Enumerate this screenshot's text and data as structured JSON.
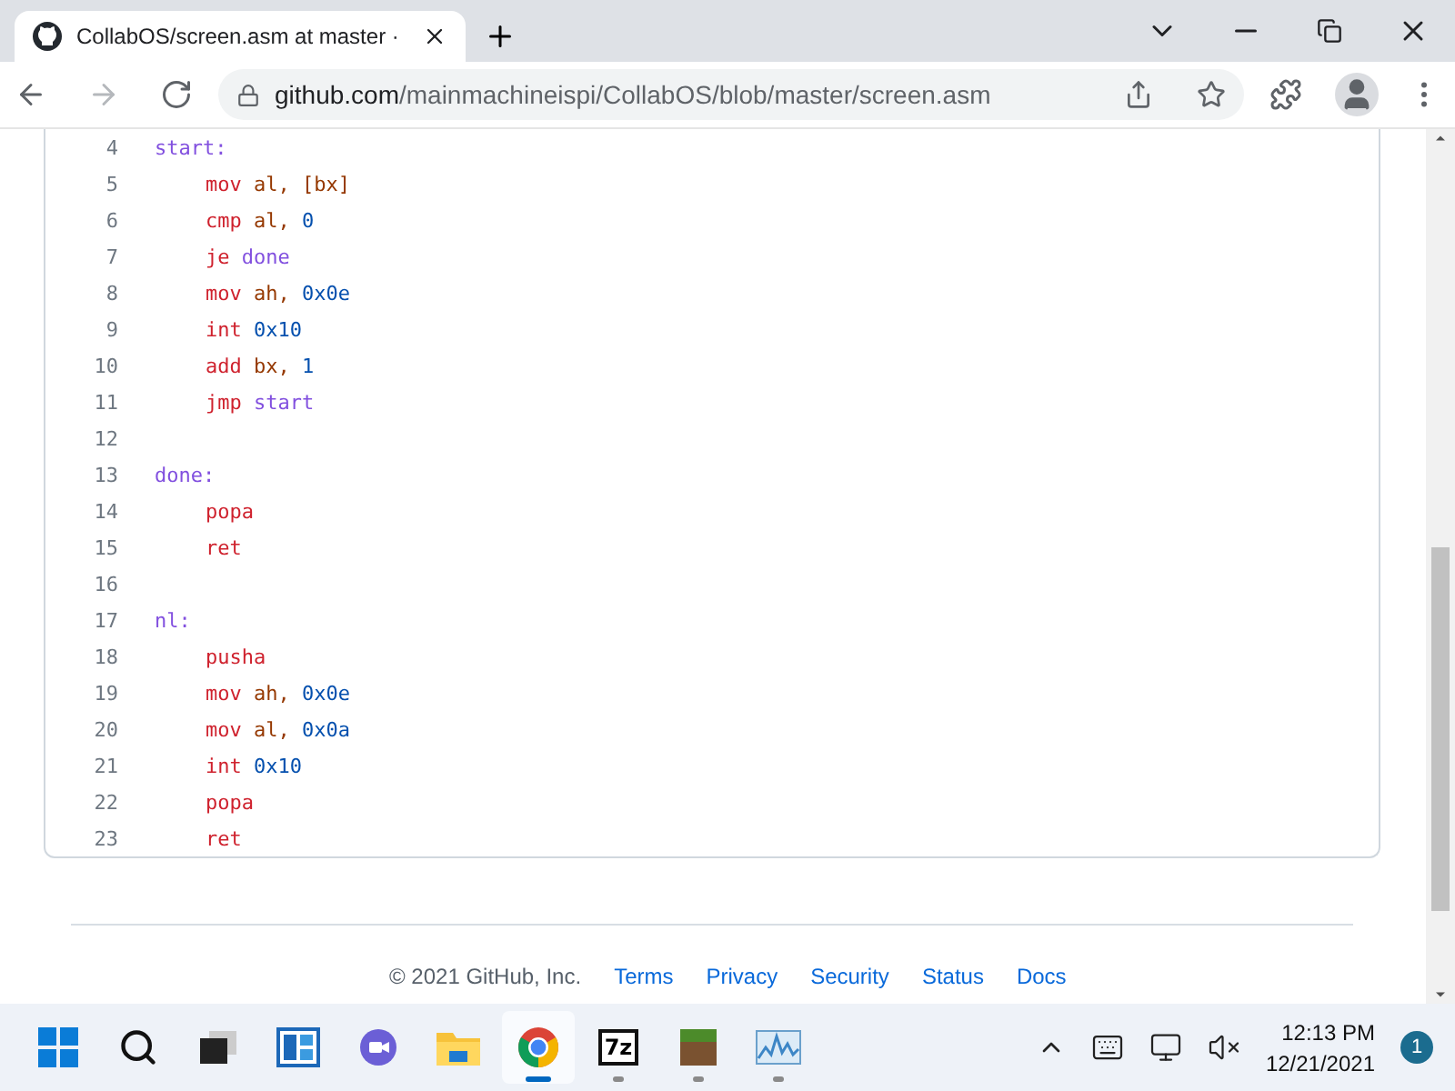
{
  "browser": {
    "tab": {
      "title": "CollabOS/screen.asm at master ·",
      "selected": true
    },
    "url": {
      "host": "github.com",
      "path": "/mainmachineispi/CollabOS/blob/master/screen.asm"
    }
  },
  "code": [
    {
      "number": "4",
      "indent": false,
      "tokens": [
        {
          "text": "start:",
          "kind": "label"
        }
      ]
    },
    {
      "number": "5",
      "indent": true,
      "tokens": [
        {
          "text": "mov",
          "kind": "keyword"
        },
        {
          "text": "al,",
          "kind": "register"
        },
        {
          "text": "[bx]",
          "kind": "register"
        }
      ]
    },
    {
      "number": "6",
      "indent": true,
      "tokens": [
        {
          "text": "cmp",
          "kind": "keyword"
        },
        {
          "text": "al,",
          "kind": "register"
        },
        {
          "text": "0",
          "kind": "number"
        }
      ]
    },
    {
      "number": "7",
      "indent": true,
      "tokens": [
        {
          "text": "je",
          "kind": "keyword"
        },
        {
          "text": "done",
          "kind": "label"
        }
      ]
    },
    {
      "number": "8",
      "indent": true,
      "tokens": [
        {
          "text": "mov",
          "kind": "keyword"
        },
        {
          "text": "ah,",
          "kind": "register"
        },
        {
          "text": "0x0e",
          "kind": "number"
        }
      ]
    },
    {
      "number": "9",
      "indent": true,
      "tokens": [
        {
          "text": "int",
          "kind": "keyword"
        },
        {
          "text": "0x10",
          "kind": "number"
        }
      ]
    },
    {
      "number": "10",
      "indent": true,
      "tokens": [
        {
          "text": "add",
          "kind": "keyword"
        },
        {
          "text": "bx,",
          "kind": "register"
        },
        {
          "text": "1",
          "kind": "number"
        }
      ]
    },
    {
      "number": "11",
      "indent": true,
      "tokens": [
        {
          "text": "jmp",
          "kind": "keyword"
        },
        {
          "text": "start",
          "kind": "label"
        }
      ]
    },
    {
      "number": "12"
    },
    {
      "number": "13",
      "indent": false,
      "tokens": [
        {
          "text": "done:",
          "kind": "label"
        }
      ]
    },
    {
      "number": "14",
      "indent": true,
      "tokens": [
        {
          "text": "popa",
          "kind": "keyword"
        }
      ]
    },
    {
      "number": "15",
      "indent": true,
      "tokens": [
        {
          "text": "ret",
          "kind": "keyword"
        }
      ]
    },
    {
      "number": "16"
    },
    {
      "number": "17",
      "indent": false,
      "tokens": [
        {
          "text": "nl:",
          "kind": "label"
        }
      ]
    },
    {
      "number": "18",
      "indent": true,
      "tokens": [
        {
          "text": "pusha",
          "kind": "keyword"
        }
      ]
    },
    {
      "number": "19",
      "indent": true,
      "tokens": [
        {
          "text": "mov",
          "kind": "keyword"
        },
        {
          "text": "ah,",
          "kind": "register"
        },
        {
          "text": "0x0e",
          "kind": "number"
        }
      ]
    },
    {
      "number": "20",
      "indent": true,
      "tokens": [
        {
          "text": "mov",
          "kind": "keyword"
        },
        {
          "text": "al,",
          "kind": "register"
        },
        {
          "text": "0x0a",
          "kind": "number"
        }
      ]
    },
    {
      "number": "21",
      "indent": true,
      "tokens": [
        {
          "text": "int",
          "kind": "keyword"
        },
        {
          "text": "0x10",
          "kind": "number"
        }
      ]
    },
    {
      "number": "22",
      "indent": true,
      "tokens": [
        {
          "text": "popa",
          "kind": "keyword"
        }
      ]
    },
    {
      "number": "23",
      "indent": true,
      "tokens": [
        {
          "text": "ret",
          "kind": "keyword"
        }
      ]
    }
  ],
  "footer": {
    "copyright": "© 2021 GitHub, Inc.",
    "links": [
      "Terms",
      "Privacy",
      "Security",
      "Status",
      "Docs"
    ]
  },
  "taskbar": {
    "apps": [
      {
        "kind": "start",
        "running": false,
        "active": false
      },
      {
        "kind": "search",
        "running": false,
        "active": false
      },
      {
        "kind": "taskview",
        "running": false,
        "active": false
      },
      {
        "kind": "widgets",
        "running": false,
        "active": false
      },
      {
        "kind": "chat",
        "running": false,
        "active": false
      },
      {
        "kind": "explorer",
        "running": false,
        "active": false
      },
      {
        "kind": "chrome",
        "running": true,
        "active": true
      },
      {
        "kind": "archiver",
        "running": true,
        "active": false
      },
      {
        "kind": "game",
        "running": true,
        "active": false
      },
      {
        "kind": "monitor",
        "running": true,
        "active": false
      }
    ],
    "time": "12:13 PM",
    "date": "12/21/2021",
    "notifications": "1",
    "archiver_label": "7z"
  }
}
